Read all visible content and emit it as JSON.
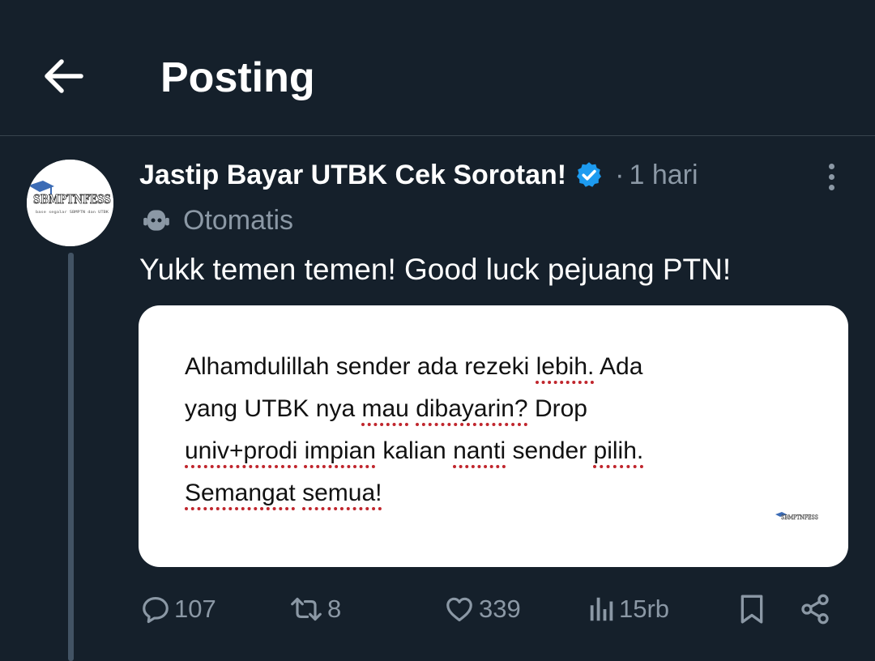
{
  "header": {
    "title": "Posting"
  },
  "tweet": {
    "author_name": "Jastip Bayar UTBK Cek Sorotan!",
    "separator": "·",
    "time": "1 hari",
    "automated_label": "Otomatis",
    "text": "Yukk temen temen! Good luck pejuang PTN!",
    "avatar_text": "SBMPTNFESS",
    "avatar_subtext": "base segalar SBMPTN dan UTBK",
    "verified_color": "#1d9bf0"
  },
  "media": {
    "lines": [
      [
        "Alhamdulillah",
        "sender",
        "ada",
        "rezeki",
        "lebih.",
        "Ada"
      ],
      [
        "yang",
        "UTBK",
        "nya",
        "mau",
        "dibayarin?",
        "Drop"
      ],
      [
        "univ+prodi",
        "impian",
        "kalian",
        "nanti",
        "sender",
        "pilih."
      ],
      [
        "Semangat",
        "semua!"
      ]
    ],
    "watermark": "SBMPTNFESS"
  },
  "actions": {
    "replies": "107",
    "reposts": "8",
    "likes": "339",
    "views": "15rb"
  },
  "colors": {
    "background": "#15202b",
    "muted": "#8b98a5",
    "border": "#38444d",
    "spellcheck": "#c0262d"
  }
}
